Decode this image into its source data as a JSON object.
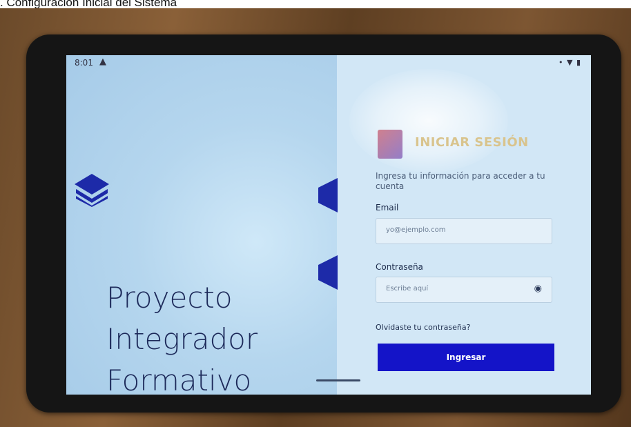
{
  "caption": ". Configuración Inicial del Sistema",
  "statusbar": {
    "time": "8:01",
    "warning_icon": "warning-icon",
    "icons": "• ▼ ▮"
  },
  "brand": {
    "title_lines": [
      "Proyecto",
      "Integrador",
      "Formativo"
    ]
  },
  "login": {
    "title": "INICIAR SESIÓN",
    "subtitle": "Ingresa tu información para acceder a tu cuenta",
    "email": {
      "label": "Email",
      "placeholder": "yo@ejemplo.com"
    },
    "password": {
      "label": "Contraseña",
      "placeholder": "Escribe aquí"
    },
    "forgot": "Olvidaste tu contraseña?",
    "submit": "Ingresar"
  },
  "colors": {
    "primary": "#1414c8",
    "brand_dark": "#1d2a5a"
  }
}
